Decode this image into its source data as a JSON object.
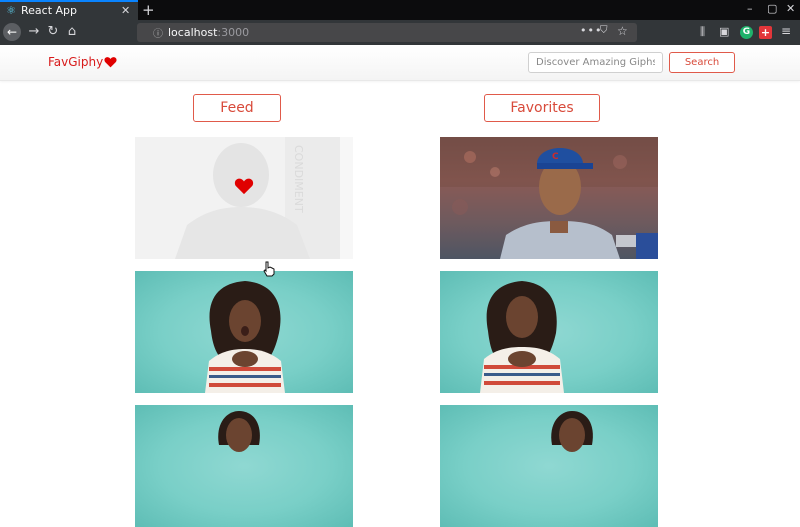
{
  "browser": {
    "tab_title": "React App",
    "tab_close": "✕",
    "new_tab": "+",
    "url_host": "localhost",
    "url_port": ":3000",
    "window_controls": [
      "–",
      "▢",
      "✕"
    ]
  },
  "header": {
    "brand": "FavGiphy",
    "brand_heart_color": "#e00000",
    "search_placeholder": "Discover Amazing Giphs!",
    "search_button": "Search"
  },
  "sections": {
    "feed_label": "Feed",
    "favorites_label": "Favorites"
  },
  "feed_gifs": [
    {
      "name": "faded-portrait-gif",
      "hovered": true,
      "heart_icon": "heart-icon"
    },
    {
      "name": "woman-teal-gif-1"
    },
    {
      "name": "woman-teal-gif-2"
    }
  ],
  "favorite_gifs": [
    {
      "name": "baseball-player-gif"
    },
    {
      "name": "woman-teal-gif-3"
    },
    {
      "name": "woman-teal-gif-4"
    }
  ],
  "colors": {
    "accent": "#e05a4a",
    "brand": "#d81b1b",
    "teal_bg": "#79cfc7"
  }
}
